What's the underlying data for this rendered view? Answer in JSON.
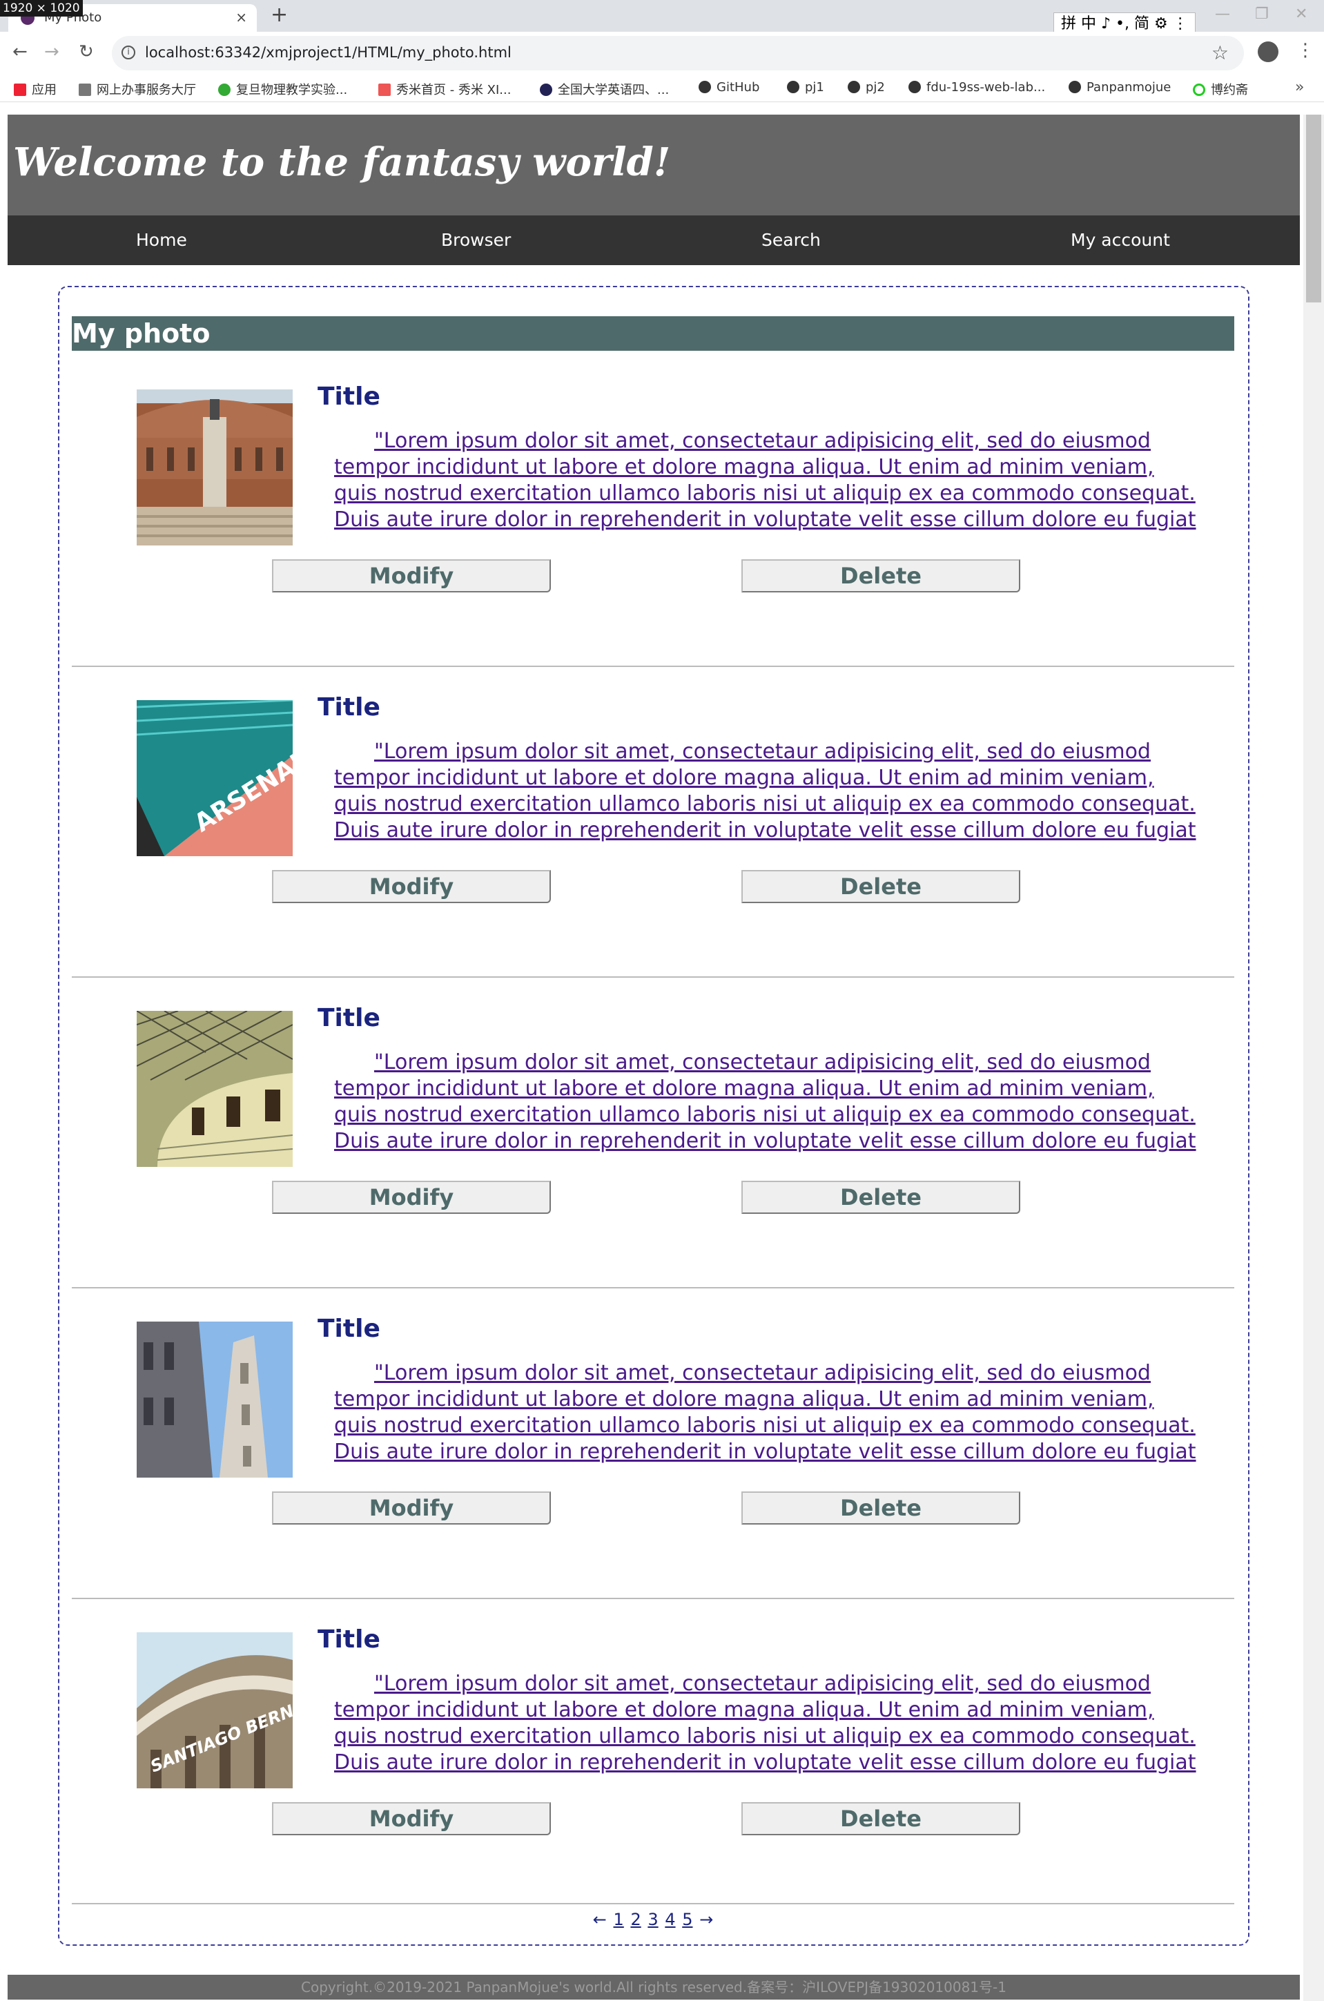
{
  "browser": {
    "size_badge": "1920 × 1020",
    "tab_title": "My Photo",
    "tab_close": "×",
    "new_tab": "+",
    "ime": "拼 中 ♪ •, 简 ⚙ ⋮",
    "minimize": "—",
    "restore": "❐",
    "close": "✕",
    "back": "←",
    "forward": "→",
    "reload": "↻",
    "info": "i",
    "url": "localhost:63342/xmjproject1/HTML/my_photo.html",
    "star": "☆",
    "menu": "⋮",
    "bookmarks": [
      "应用",
      "网上办事服务大厅",
      "复旦物理教学实验...",
      "秀米首页 - 秀米 XI...",
      "全国大学英语四、...",
      "GitHub",
      "pj1",
      "pj2",
      "fdu-19ss-web-lab...",
      "Panpanmojue",
      "博约斋"
    ],
    "bookmarks_more": "»"
  },
  "header": {
    "title": "Welcome to the fantasy world!"
  },
  "nav": {
    "items": [
      "Home",
      "Browser",
      "Search",
      "My account"
    ]
  },
  "section": {
    "heading": "My photo"
  },
  "photos": [
    {
      "title": "Title",
      "description": "\"Lorem ipsum dolor sit amet, consectetaur adipisicing elit, sed do eiusmod tempor incididunt ut labore et dolore magna aliqua. Ut enim ad minim veniam, quis nostrud exercitation ullamco laboris nisi ut aliquip ex ea commodo consequat. Duis aute irure dolor in reprehenderit in voluptate velit esse cillum dolore eu fugiat null…",
      "modify": "Modify",
      "delete": "Delete"
    },
    {
      "title": "Title",
      "description": "\"Lorem ipsum dolor sit amet, consectetaur adipisicing elit, sed do eiusmod tempor incididunt ut labore et dolore magna aliqua. Ut enim ad minim veniam, quis nostrud exercitation ullamco laboris nisi ut aliquip ex ea commodo consequat. Duis aute irure dolor in reprehenderit in voluptate velit esse cillum dolore eu fugiat null…",
      "modify": "Modify",
      "delete": "Delete"
    },
    {
      "title": "Title",
      "description": "\"Lorem ipsum dolor sit amet, consectetaur adipisicing elit, sed do eiusmod tempor incididunt ut labore et dolore magna aliqua. Ut enim ad minim veniam, quis nostrud exercitation ullamco laboris nisi ut aliquip ex ea commodo consequat. Duis aute irure dolor in reprehenderit in voluptate velit esse cillum dolore eu fugiat null…",
      "modify": "Modify",
      "delete": "Delete"
    },
    {
      "title": "Title",
      "description": "\"Lorem ipsum dolor sit amet, consectetaur adipisicing elit, sed do eiusmod tempor incididunt ut labore et dolore magna aliqua. Ut enim ad minim veniam, quis nostrud exercitation ullamco laboris nisi ut aliquip ex ea commodo consequat. Duis aute irure dolor in reprehenderit in voluptate velit esse cillum dolore eu fugiat null…",
      "modify": "Modify",
      "delete": "Delete"
    },
    {
      "title": "Title",
      "description": "\"Lorem ipsum dolor sit amet, consectetaur adipisicing elit, sed do eiusmod tempor incididunt ut labore et dolore magna aliqua. Ut enim ad minim veniam, quis nostrud exercitation ullamco laboris nisi ut aliquip ex ea commodo consequat. Duis aute irure dolor in reprehenderit in voluptate velit esse cillum dolore eu fugiat null…",
      "modify": "Modify",
      "delete": "Delete"
    }
  ],
  "pagination": {
    "prev": "←",
    "pages": [
      "1",
      "2",
      "3",
      "4",
      "5"
    ],
    "next": "→"
  },
  "footer": {
    "text": "Copyright.©2019-2021 PanpanMojue's world.All rights reserved.备案号：沪ILOVEPJ备19302010081号-1"
  },
  "colors": {
    "header_bg": "#666666",
    "nav_bg": "#333333",
    "section_heading_bg": "#4f6a6a",
    "title_color": "#1a237e",
    "link_color": "#4a1a8a"
  }
}
